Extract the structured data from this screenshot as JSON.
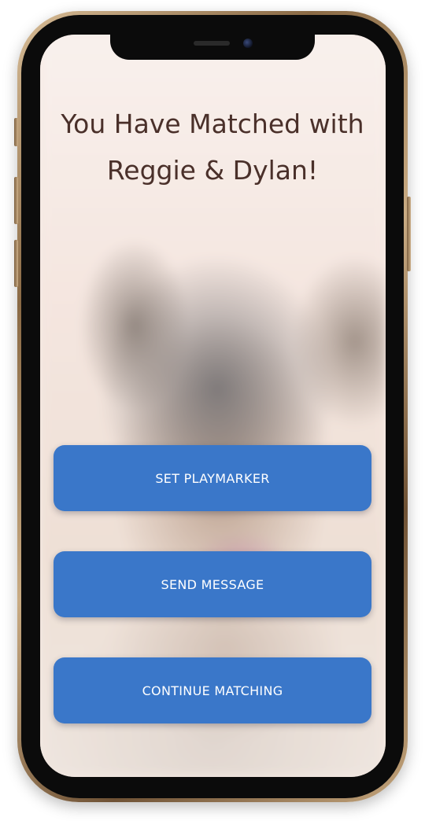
{
  "match_screen": {
    "title": "You Have Matched with Reggie & Dylan!",
    "buttons": {
      "set_playmarker": "SET PLAYMARKER",
      "send_message": "SEND MESSAGE",
      "continue_matching": "CONTINUE MATCHING"
    },
    "button_color": "#3a77c9",
    "title_color": "#4a302a",
    "background_image": "blurred-boxer-dog-photo"
  }
}
